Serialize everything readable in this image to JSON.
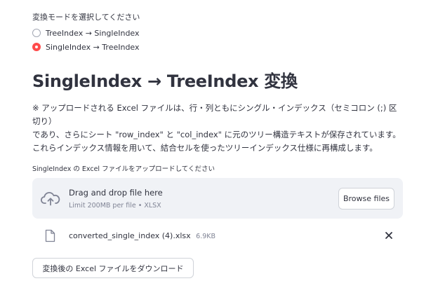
{
  "mode_selector": {
    "caption": "変換モードを選択してください",
    "options": [
      {
        "label": "TreeIndex → SingleIndex",
        "selected": false
      },
      {
        "label": "SingleIndex → TreeIndex",
        "selected": true
      }
    ],
    "accent_color": "#ff4b4b"
  },
  "main": {
    "heading": "SingleIndex → TreeIndex 変換",
    "description_lines": [
      "※ アップロードされる Excel ファイルは、行・列ともにシングル・インデックス（セミコロン (;) 区",
      "切り）",
      "であり、さらにシート \"row_index\" と \"col_index\" に元のツリー構造テキストが保存されています。",
      "これらインデックス情報を用いて、結合セルを使ったツリーインデックス仕様に再構成します。"
    ]
  },
  "uploader": {
    "caption": "SingleIndex の Excel ファイルをアップロードしてください",
    "drop_title": "Drag and drop file here",
    "limit_text": "Limit 200MB per file • XLSX",
    "browse_label": "Browse files",
    "icons": {
      "upload": "cloud-upload-icon"
    }
  },
  "uploaded_file": {
    "name": "converted_single_index (4).xlsx",
    "size": "6.9KB",
    "icons": {
      "file": "file-icon",
      "remove": "close-icon"
    }
  },
  "download": {
    "label": "変換後の Excel ファイルをダウンロード"
  }
}
